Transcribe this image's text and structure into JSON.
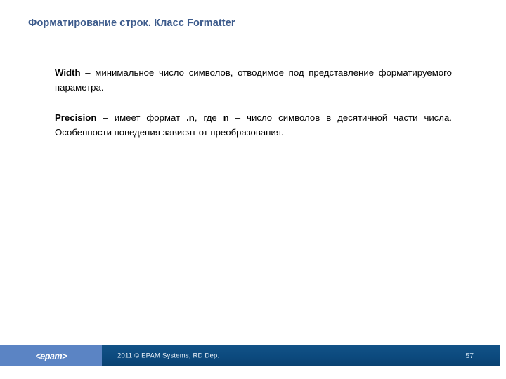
{
  "slide": {
    "title": "Форматирование строк. Класс Formatter",
    "background_color": "#ffffff",
    "title_color": "#3D5B8C"
  },
  "content": {
    "paragraphs": [
      {
        "term": "Width",
        "dash": " – ",
        "text": "минимальное число символов, отводимое под представление форматируемого параметра."
      },
      {
        "term": "Precision",
        "dash": " – ",
        "text_part1": "имеет формат ",
        "inline_code1": ".n",
        "text_part2": ", где ",
        "inline_code2": "n",
        "text_part3": " – число символов в десятичной части числа. Особенности поведения зависят от преобразования."
      }
    ]
  },
  "footer": {
    "logo_text": "<epam>",
    "logo_bg_color": "#5B84C4",
    "bar_color": "#0C4A7E",
    "copyright": "2011 © EPAM Systems, RD Dep.",
    "slide_number": "57"
  }
}
